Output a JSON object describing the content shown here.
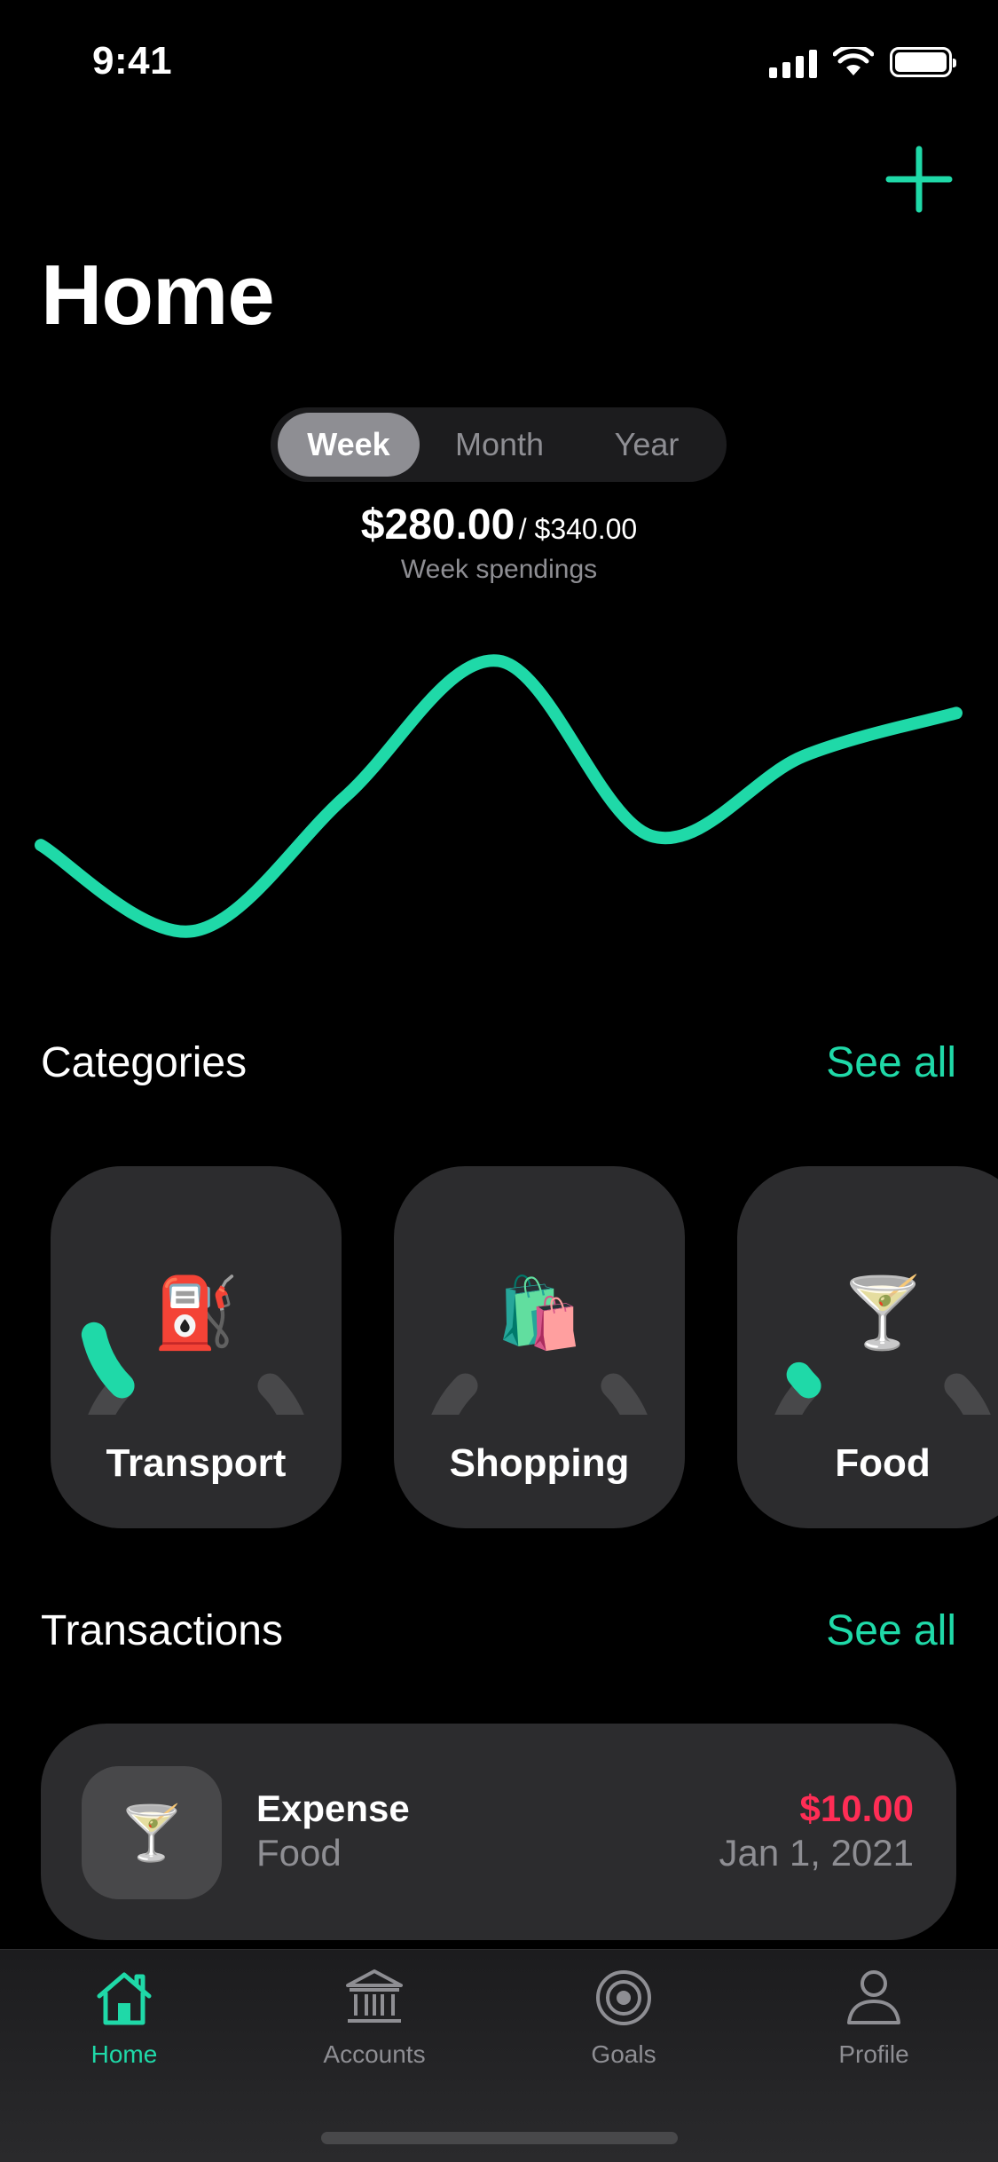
{
  "status_bar": {
    "time": "9:41"
  },
  "header": {
    "title": "Home",
    "add_icon": "plus-icon"
  },
  "period_selector": {
    "options": [
      "Week",
      "Month",
      "Year"
    ],
    "selected": "Week"
  },
  "summary": {
    "amount": "$280.00",
    "budget": "/ $340.00",
    "label": "Week spendings"
  },
  "chart_data": {
    "type": "line",
    "x": [
      0,
      1,
      2,
      3,
      4,
      5,
      6
    ],
    "series": [
      {
        "values": [
          0.3,
          0.02,
          0.46,
          0.9,
          0.33,
          0.59,
          0.73
        ]
      }
    ],
    "color": "#1FD9A8",
    "grid": false
  },
  "categories": {
    "title": "Categories",
    "see_all": "See all",
    "items": [
      {
        "name": "Transport",
        "icon": "fuel-pump-icon",
        "emoji": "⛽",
        "progress": 0.12
      },
      {
        "name": "Shopping",
        "icon": "shopping-bags-icon",
        "emoji": "🛍️",
        "progress": 0
      },
      {
        "name": "Food",
        "icon": "cocktail-icon",
        "emoji": "🍸",
        "progress": 0.03
      }
    ]
  },
  "transactions": {
    "title": "Transactions",
    "see_all": "See all",
    "items": [
      {
        "type": "Expense",
        "category": "Food",
        "amount": "$10.00",
        "date": "Jan 1, 2021",
        "icon": "cocktail-icon",
        "emoji": "🍸"
      }
    ]
  },
  "tab_bar": {
    "items": [
      {
        "label": "Home",
        "icon": "home-icon",
        "active": true
      },
      {
        "label": "Accounts",
        "icon": "bank-icon",
        "active": false
      },
      {
        "label": "Goals",
        "icon": "target-icon",
        "active": false
      },
      {
        "label": "Profile",
        "icon": "person-icon",
        "active": false
      }
    ]
  },
  "colors": {
    "accent": "#1FD9A8",
    "negative": "#FF2D55",
    "card": "#2C2C2E",
    "background": "#000000"
  }
}
